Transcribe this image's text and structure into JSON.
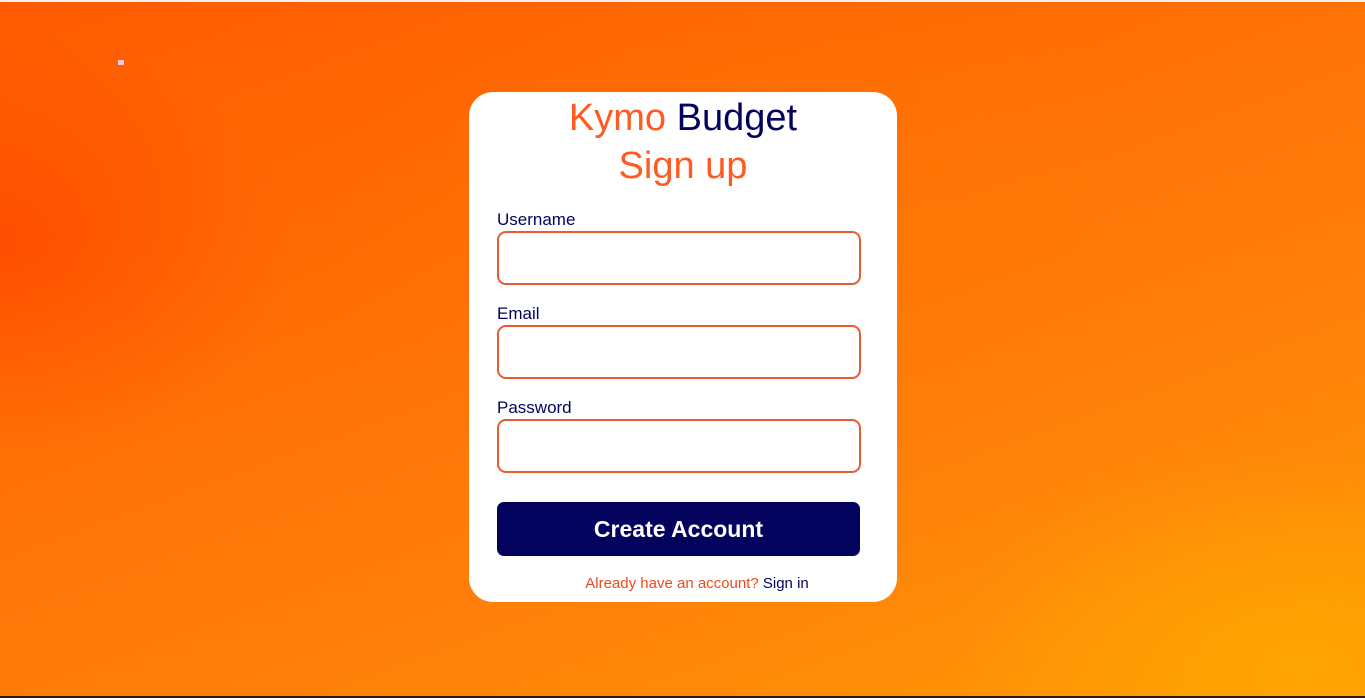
{
  "brand": {
    "name_part1": "Kymo",
    "name_part2": "Budget"
  },
  "form": {
    "title": "Sign up",
    "username_label": "Username",
    "username_value": "",
    "email_label": "Email",
    "email_value": "",
    "password_label": "Password",
    "password_value": "",
    "submit_label": "Create Account"
  },
  "footer": {
    "prompt": "Already have an account?",
    "link_label": "Sign in"
  },
  "colors": {
    "accent": "#ff5a1f",
    "primary": "#03035e",
    "background": "#ff7a00"
  }
}
